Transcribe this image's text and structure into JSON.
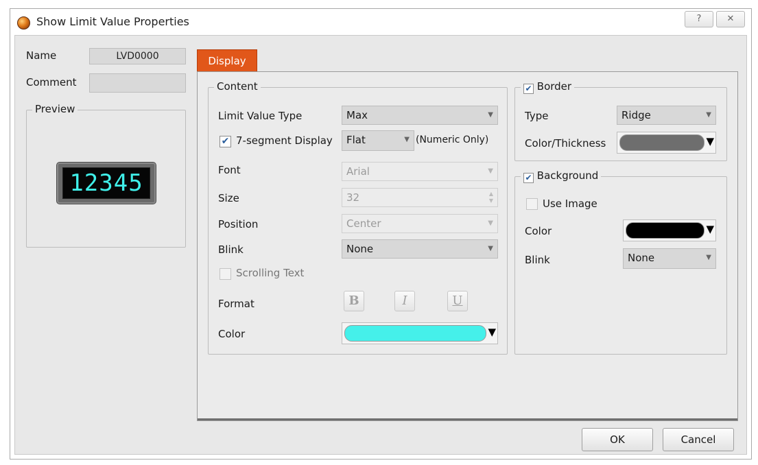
{
  "window": {
    "title": "Show Limit Value Properties",
    "help_button": "?",
    "close_button": "✕"
  },
  "left": {
    "name_label": "Name",
    "name_value": "LVD0000",
    "comment_label": "Comment",
    "comment_value": "",
    "preview_label": "Preview",
    "preview_value": "12345"
  },
  "tabs": [
    "Display"
  ],
  "content": {
    "legend": "Content",
    "limit_type_label": "Limit Value Type",
    "limit_type_value": "Max",
    "seven_seg_label": "7-segment Display",
    "seven_seg_checked": true,
    "seven_seg_style": "Flat",
    "numeric_only_note": "(Numeric Only)",
    "font_label": "Font",
    "font_value": "Arial",
    "size_label": "Size",
    "size_value": "32",
    "position_label": "Position",
    "position_value": "Center",
    "blink_label": "Blink",
    "blink_value": "None",
    "scrolling_label": "Scrolling Text",
    "scrolling_checked": false,
    "format_label": "Format",
    "bold": "B",
    "italic": "I",
    "underline": "U",
    "color_label": "Color",
    "color_value": "#45f0ea"
  },
  "border": {
    "legend": "Border",
    "checked": true,
    "type_label": "Type",
    "type_value": "Ridge",
    "color_label": "Color/Thickness",
    "color_value": "#6e6e6e"
  },
  "background": {
    "legend": "Background",
    "checked": true,
    "use_image_label": "Use Image",
    "use_image_checked": false,
    "color_label": "Color",
    "color_value": "#000000",
    "blink_label": "Blink",
    "blink_value": "None"
  },
  "buttons": {
    "ok": "OK",
    "cancel": "Cancel"
  }
}
